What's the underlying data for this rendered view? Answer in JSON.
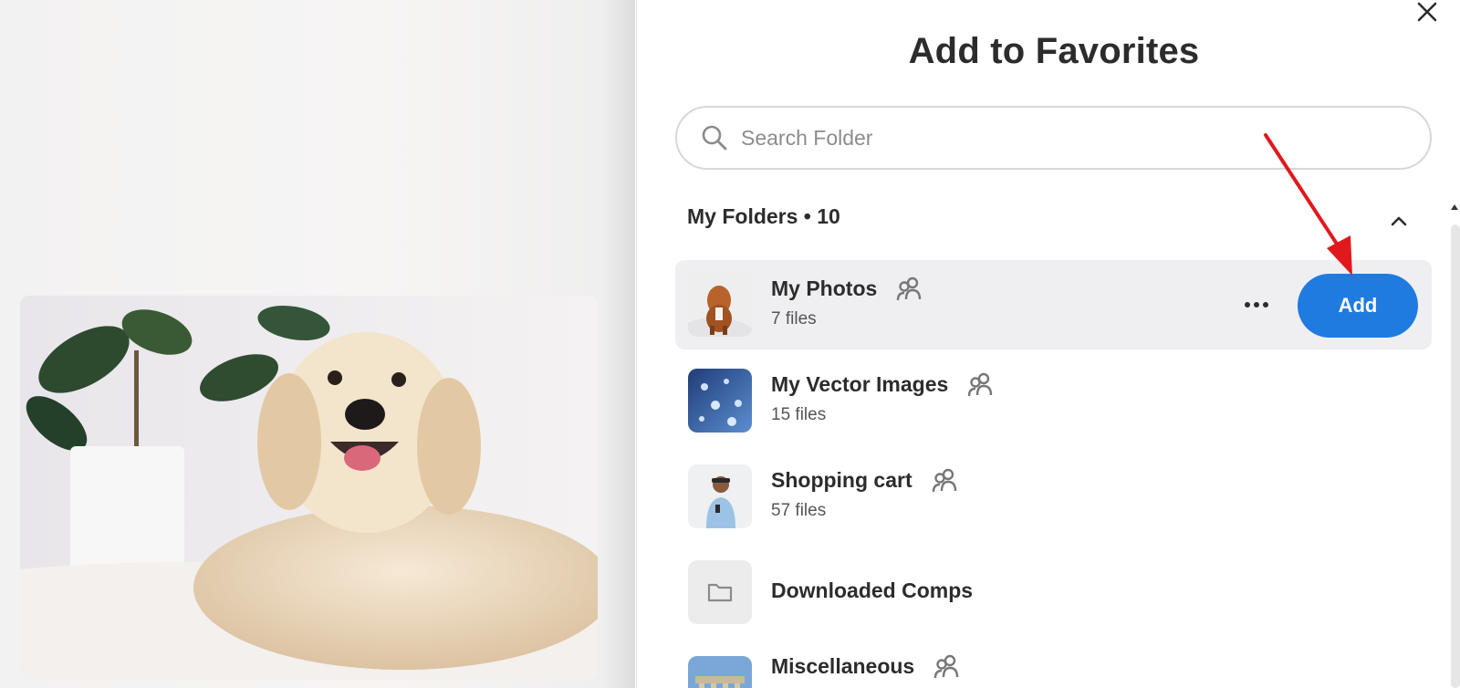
{
  "dialog": {
    "title": "Add to Favorites",
    "close_icon": "close-icon"
  },
  "search": {
    "placeholder": "Search Folder",
    "value": "",
    "icon": "search-icon"
  },
  "folders": {
    "header": "My Folders • 10",
    "toggle_icon": "chevron-up-icon",
    "items": [
      {
        "name": "My Photos",
        "count": "7 files",
        "shared": true,
        "thumbnail": "dog-photo",
        "selected": true
      },
      {
        "name": "My Vector Images",
        "count": "15 files",
        "shared": true,
        "thumbnail": "water-drops"
      },
      {
        "name": "Shopping cart",
        "count": "57 files",
        "shared": true,
        "thumbnail": "man-with-headphones"
      },
      {
        "name": "Downloaded Comps",
        "count": "",
        "shared": false,
        "thumbnail": "folder-icon"
      },
      {
        "name": "Miscellaneous",
        "count": "",
        "shared": true,
        "thumbnail": "temple"
      }
    ]
  },
  "actions": {
    "add_label": "Add",
    "more_icon": "more-horizontal-icon"
  },
  "colors": {
    "accent": "#1f7be0",
    "annotation_arrow": "#e0191e",
    "selected_row": "#efeff1"
  }
}
